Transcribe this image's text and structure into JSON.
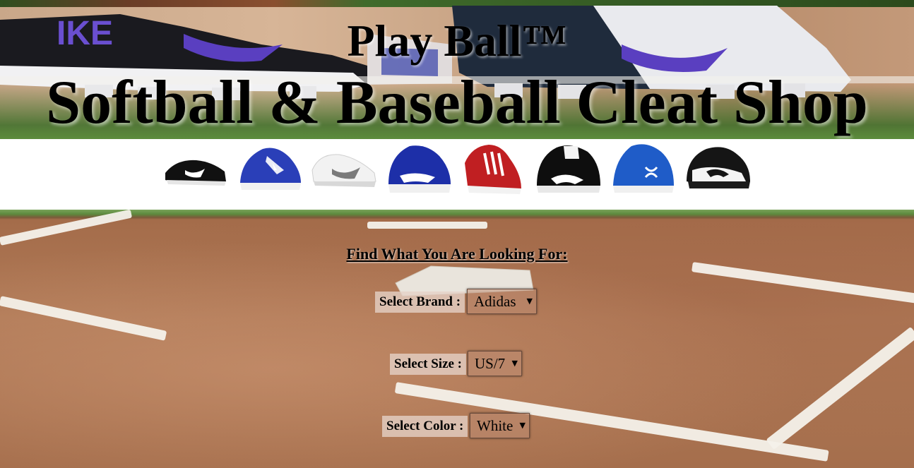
{
  "header": {
    "title": "Play Ball™",
    "subtitle": "Softball & Baseball Cleat Shop",
    "hero_brand_text": "IKE"
  },
  "products": [
    {
      "name": "black-white-cleat",
      "colors": [
        "#111111",
        "#ffffff"
      ]
    },
    {
      "name": "blue-newbalance-cleat",
      "colors": [
        "#2a3fb8",
        "#ffffff"
      ]
    },
    {
      "name": "white-gray-cleat",
      "colors": [
        "#f2f2f2",
        "#7a7a7a"
      ]
    },
    {
      "name": "blue-mizuno-cleat",
      "colors": [
        "#1d2fa8",
        "#ffffff"
      ]
    },
    {
      "name": "red-adidas-cleat",
      "colors": [
        "#c01f22",
        "#ffffff"
      ]
    },
    {
      "name": "black-mizuno-cleat",
      "colors": [
        "#0e0e0e",
        "#ffffff"
      ]
    },
    {
      "name": "blue-underarmour-cleat",
      "colors": [
        "#1f5cc8",
        "#ffffff"
      ]
    },
    {
      "name": "black-white-mizuno-cleat",
      "colors": [
        "#151515",
        "#f4f4f4"
      ]
    }
  ],
  "filters": {
    "heading": "Find What You Are Looking For:",
    "brand": {
      "label": "Select Brand :",
      "value": "Adidas"
    },
    "size": {
      "label": "Select Size :",
      "value": "US/7"
    },
    "color": {
      "label": "Select Color :",
      "value": "White"
    }
  }
}
